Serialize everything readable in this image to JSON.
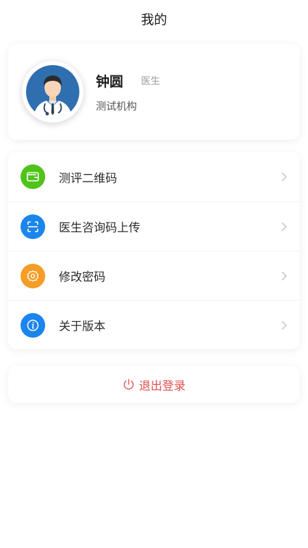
{
  "header": {
    "title": "我的"
  },
  "profile": {
    "name": "钟圆",
    "role": "医生",
    "organization": "测试机构",
    "avatar_icon": "doctor-avatar-icon"
  },
  "menu": {
    "items": [
      {
        "label": "测评二维码",
        "icon": "wallet-icon",
        "color": "#4fc31a"
      },
      {
        "label": "医生咨询码上传",
        "icon": "scan-icon",
        "color": "#1c85ec"
      },
      {
        "label": "修改密码",
        "icon": "gear-icon",
        "color": "#f59d27"
      },
      {
        "label": "关于版本",
        "icon": "info-icon",
        "color": "#1c85ec"
      }
    ]
  },
  "logout": {
    "label": "退出登录",
    "icon": "power-icon",
    "color": "#e0504f"
  }
}
